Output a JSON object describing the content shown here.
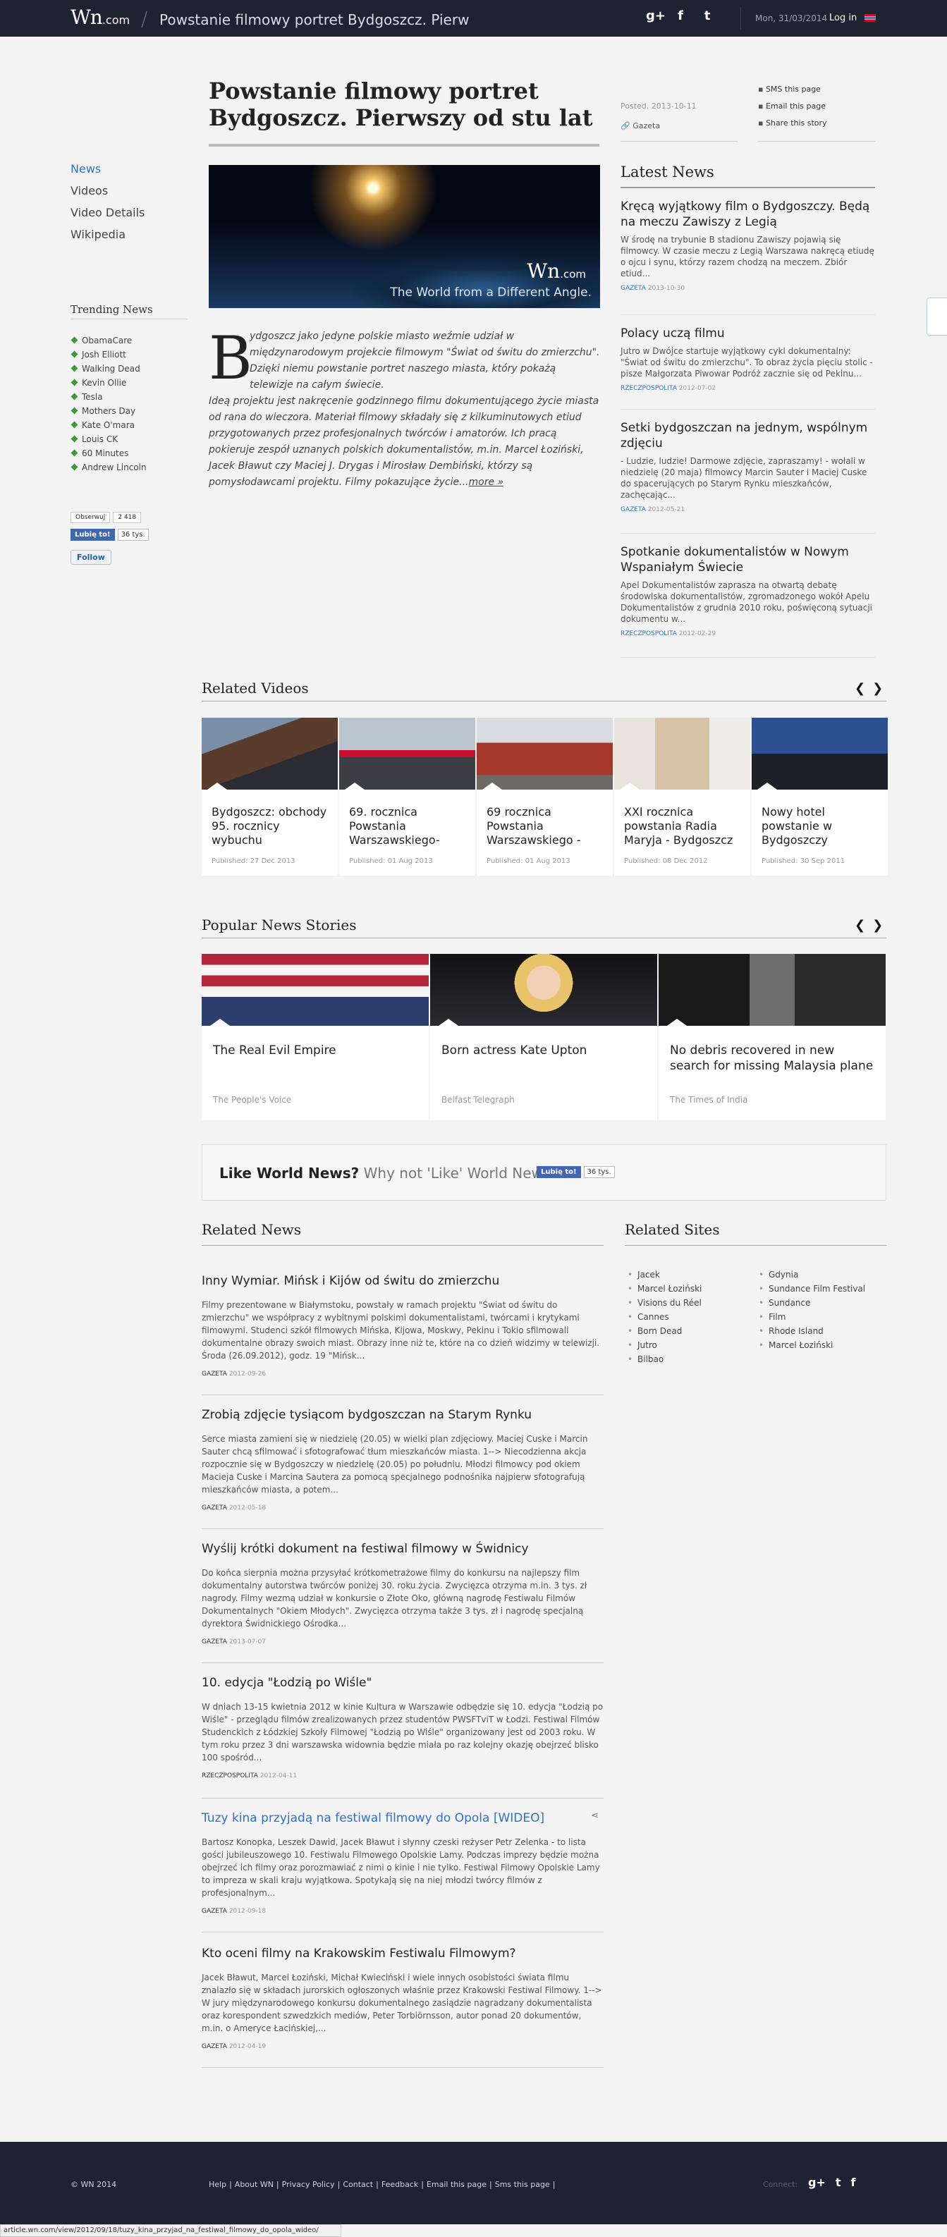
{
  "header": {
    "logo": "Wn",
    "logo_suffix": ".com",
    "page_title": "Powstanie filmowy portret Bydgoszcz. Pierwszy",
    "date": "Mon, 31/03/2014",
    "login": "Log in",
    "social": [
      "g+",
      "f",
      "t"
    ]
  },
  "leftnav": {
    "items": [
      "News",
      "Videos",
      "Video Details",
      "Wikipedia"
    ],
    "trending_title": "Trending News",
    "trending": [
      "ObamaCare",
      "Josh Elliott",
      "Walking Dead",
      "Kevin Ollie",
      "Tesla",
      "Mothers Day",
      "Kate O'mara",
      "Louis CK",
      "60 Minutes",
      "Andrew Lincoln"
    ],
    "gplus": {
      "label": "Obserwuj",
      "count": "2 418"
    },
    "fb": {
      "label": "Lubię to!",
      "count": "36 tys."
    },
    "twitter": "Follow"
  },
  "article": {
    "title": "Powstanie filmowy portret Bydgoszcz. Pierwszy od stu lat",
    "hero_logo": "Wn",
    "hero_logo_suffix": ".com",
    "hero_tagline": "The World from a Different Angle.",
    "dropcap": "B",
    "body_lead": "ydgoszcz jako jedyne polskie miasto weźmie udział w międzynarodowym projekcie filmowym \"Świat od świtu do zmierzchu\". Dzięki niemu powstanie portret naszego miasta, który pokażą telewizje na całym świecie.",
    "body_rest": "Ideą projektu jest nakręcenie godzinnego filmu dokumentującego życie miasta od rana do wieczora. Materiał filmowy składały się z kilkuminutowych etiud przygotowanych przez profesjonalnych twórców i amatorów. Ich pracą pokieruje zespół uznanych polskich dokumentalistów, m.in. Marcel Łoziński, Jacek Bławut czy Maciej J. Drygas i Mirosław Dembiński, którzy są pomysłodawcami projektu. Filmy pokazujące życie...",
    "more": "more »",
    "posted": "Posted, 2013-10-11",
    "source": "Gazeta",
    "share": [
      "SMS this page",
      "Email this page",
      "Share this story"
    ]
  },
  "latest": {
    "title": "Latest News",
    "items": [
      {
        "title": "Kręcą wyjątkowy film o Bydgoszczy. Będą na meczu Zawiszy z Legią",
        "text": "W środę na trybunie B stadionu Zawiszy pojawią się filmowcy. W czasie meczu z Legią Warszawa nakręcą etiudę o ojcu i synu, którzy razem chodzą na meczem. Zbiór etiud...",
        "src": "GAZETA",
        "date": "2013-10-30"
      },
      {
        "title": "Polacy uczą filmu",
        "text": "Jutro w Dwójce startuje wyjątkowy cykl dokumentalny: \"Świat od świtu do zmierzchu\". To obraz życia pięciu stolic - pisze Małgorzata Piwowar Podróż zacznie się od Pekinu...",
        "src": "RZECZPOSPOLITA",
        "date": "2012-07-02"
      },
      {
        "title": "Setki bydgoszczan na jednym, wspólnym zdjęciu",
        "text": "- Ludzie, ludzie! Darmowe zdjęcie, zapraszamy! - wołali w niedzielę (20 maja) filmowcy Marcin Sauter i Maciej Cuske do spacerujących po Starym Rynku mieszkańców, zachęcając...",
        "src": "GAZETA",
        "date": "2012-05-21"
      },
      {
        "title": "Spotkanie dokumentalistów w Nowym Wspaniałym Świecie",
        "text": "Apel Dokumentalistów zaprasza na otwartą debatę środowiska dokumentalistów, zgromadzonego wokół Apelu Dokumentalistów z grudnia 2010 roku, poświęconą sytuacji dokumentu w...",
        "src": "RZECZPOSPOLITA",
        "date": "2012-02-29"
      }
    ]
  },
  "related_videos": {
    "title": "Related Videos",
    "items": [
      {
        "title": "Bydgoszcz: obchody 95. rocznicy wybuchu",
        "published": "Published: 27 Dec 2013"
      },
      {
        "title": "69. rocznica Powstania Warszawskiego-",
        "published": "Published: 01 Aug 2013"
      },
      {
        "title": "69 rocznica Powstania Warszawskiego -",
        "published": "Published: 01 Aug 2013"
      },
      {
        "title": "XXI rocznica powstania Radia Maryja - Bydgoszcz",
        "published": "Published: 08 Dec 2012"
      },
      {
        "title": "Nowy hotel powstanie w Bydgoszczy",
        "published": "Published: 30 Sep 2011"
      }
    ]
  },
  "popular": {
    "title": "Popular News Stories",
    "items": [
      {
        "title": "The Real Evil Empire",
        "source": "The People's Voice"
      },
      {
        "title": "Born actress Kate Upton",
        "source": "Belfast Telegraph"
      },
      {
        "title": "No debris recovered in new search for missing Malaysia plane",
        "source": "The Times of India"
      }
    ]
  },
  "like_box": {
    "bold": "Like World News?",
    "rest": "Why not 'Like' World News",
    "fb": "Lubię to!",
    "count": "36 tys."
  },
  "related_news": {
    "title": "Related News",
    "items": [
      {
        "title": "Inny Wymiar. Mińsk i Kijów od świtu do zmierzchu",
        "text": "Filmy prezentowane w Białymstoku, powstały w ramach projektu \"Świat od świtu do zmierzchu\" we współpracy z wybitnymi polskimi dokumentalistami, twórcami i krytykami filmowymi. Studenci szkół filmowych Mińska, Kijowa, Moskwy, Pekinu i Tokio sfilmowali dokumentalne obrazy swoich miast. Obrazy inne niż te, które na co dzień widzimy w telewizji. Środa (26.09.2012), godz. 19 \"Mińsk...",
        "src": "GAZETA",
        "date": "2012-09-26"
      },
      {
        "title": "Zrobią zdjęcie tysiącom bydgoszczan na Starym Rynku",
        "text": "Serce miasta zamieni się w niedzielę (20.05) w wielki plan zdjęciowy. Maciej Cuske i Marcin Sauter chcą sfilmować i sfotografować tłum mieszkańców miasta. 1--> Niecodzienna akcja rozpocznie się w Bydgoszczy w niedzielę (20.05) po południu. Młodzi filmowcy pod okiem Macieja Cuske i Marcina Sautera za pomocą specjalnego podnośnika najpierw sfotografują mieszkańców miasta, a potem...",
        "src": "GAZETA",
        "date": "2012-05-18"
      },
      {
        "title": "Wyślij krótki dokument na festiwal filmowy w Świdnicy",
        "text": "Do końca sierpnia można przysyłać krótkometrażowe filmy do konkursu na najlepszy film dokumentalny autorstwa twórców poniżej 30. roku życia. Zwycięzca otrzyma m.in. 3 tys. zł nagrody. Filmy wezmą udział w konkursie o Złote Oko, główną nagrodę Festiwalu Filmów Dokumentalnych \"Okiem Młodych\". Zwycięzca otrzyma także 3 tys. zł i nagrodę specjalną dyrektora Świdnickiego Ośrodka...",
        "src": "GAZETA",
        "date": "2013-07-07"
      },
      {
        "title": "10. edycja \"Łodzią po Wiśle\"",
        "text": "W dniach 13-15 kwietnia 2012 w kinie Kultura w Warszawie odbędzie się 10. edycja \"Łodzią po Wiśle\" - przeglądu filmów zrealizowanych przez studentów PWSFTviT w Łodzi. Festiwal Filmów Studenckich z Łódzkiej Szkoły Filmowej \"Łodzią po Wiśle\" organizowany jest od 2003 roku. W tym roku przez 3 dni warszawska widownia będzie miała po raz kolejny okazję obejrzeć blisko 100 spośród...",
        "src": "RZECZPOSPOLITA",
        "date": "2012-04-11"
      },
      {
        "title": "Tuzy kina przyjadą na festiwal filmowy do Opola [WIDEO]",
        "text": "Bartosz Konopka, Leszek Dawid, Jacek Bławut i słynny czeski reżyser Petr Zelenka - to lista gości jubileuszowego 10. Festiwalu Filmowego Opolskie Lamy. Podczas imprezy będzie można obejrzeć ich filmy oraz porozmawiać z nimi o kinie i nie tylko. Festiwal Filmowy Opolskie Lamy to impreza w skali kraju wyjątkowa. Spotykają się na niej młodzi twórcy filmów z profesjonalnym...",
        "src": "GAZETA",
        "date": "2012-09-18"
      },
      {
        "title": "Kto oceni filmy na Krakowskim Festiwalu Filmowym?",
        "text": "Jacek Bławut, Marcel Łoziński, Michał Kwieciński i wiele innych osobistości świata filmu znalazło się w składach jurorskich ogłoszonych właśnie przez Krakowski Festiwal Filmowy. 1--> W jury międzynarodowego konkursu dokumentalnego zasiądzie nagradzany dokumentalista oraz korespondent szwedzkich mediów, Peter Torbiörnsson, autor ponad 20 dokumentów, m.in. o Ameryce Łacińskiej,...",
        "src": "GAZETA",
        "date": "2012-04-19"
      }
    ]
  },
  "related_sites": {
    "title": "Related Sites",
    "col1": [
      "Jacek",
      "Marcel Łoziński",
      "Visions du Réel",
      "Cannes",
      "Born Dead",
      "Jutro",
      "Bilbao"
    ],
    "col2": [
      "Gdynia",
      "Sundance Film Festival",
      "Sundance",
      "Film",
      "Rhode Island",
      "Marcel Łoziński"
    ]
  },
  "footer": {
    "copyright": "© WN 2014",
    "links": [
      "Help",
      "About WN",
      "Privacy Policy",
      "Contact",
      "Feedback",
      "Email this page",
      "Sms this page"
    ],
    "connect": "Connect:"
  },
  "statusbar": "article.wn.com/view/2012/09/18/tuzy_kina_przyjad_na_festiwal_filmowy_do_opola_wideo/",
  "colors": {
    "header_bg": "#1d2331",
    "link_blue": "#2f72c4",
    "trend_bullet": "#3a9a3a"
  }
}
